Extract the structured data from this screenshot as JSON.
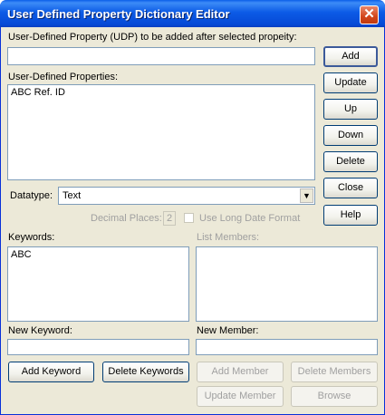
{
  "window": {
    "title": "User Defined Property Dictionary Editor",
    "close_glyph": "✕"
  },
  "udp": {
    "label": "User-Defined Property (UDP)  to be added after selected propeity:",
    "value": ""
  },
  "properties": {
    "label": "User-Defined Properties:",
    "items": [
      "ABC Ref. ID"
    ]
  },
  "side_buttons": {
    "add": "Add",
    "update": "Update",
    "up": "Up",
    "down": "Down",
    "delete": "Delete",
    "close": "Close",
    "help": "Help"
  },
  "datatype": {
    "label": "Datatype:",
    "value": "Text"
  },
  "decimal": {
    "label": "Decimal Places:",
    "value": "2"
  },
  "long_date": {
    "label": "Use Long Date Format",
    "checked": false
  },
  "keywords": {
    "label": "Keywords:",
    "items": [
      "ABC"
    ]
  },
  "list_members": {
    "label": "List Members:",
    "items": []
  },
  "new_keyword": {
    "label": "New Keyword:",
    "value": ""
  },
  "new_member": {
    "label": "New Member:",
    "value": ""
  },
  "bottom_buttons": {
    "add_keyword": "Add Keyword",
    "delete_keywords": "Delete Keywords",
    "add_member": "Add Member",
    "delete_members": "Delete Members",
    "update_member": "Update Member",
    "browse": "Browse"
  }
}
